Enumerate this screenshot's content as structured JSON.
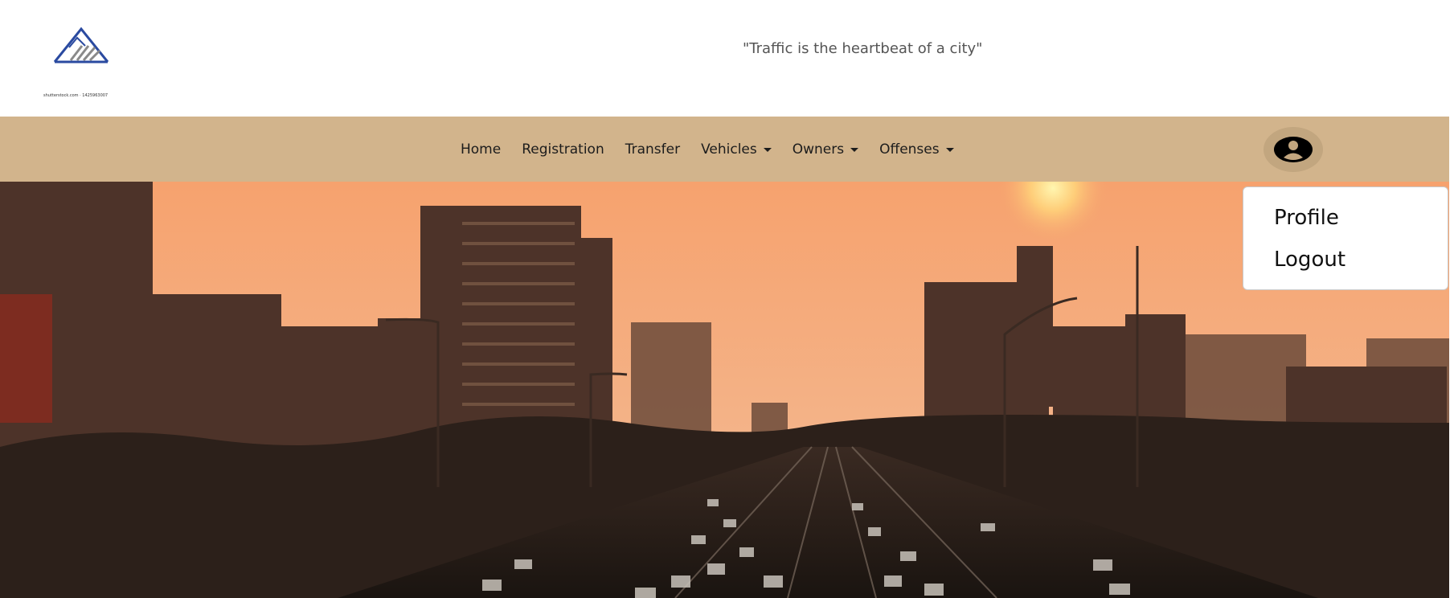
{
  "header": {
    "logo_caption": "shutterstock.com · 1425963007",
    "tagline": "\"Traffic is the heartbeat of a city\""
  },
  "nav": {
    "items": [
      {
        "label": "Home",
        "has_dropdown": false
      },
      {
        "label": "Registration",
        "has_dropdown": false
      },
      {
        "label": "Transfer",
        "has_dropdown": false
      },
      {
        "label": "Vehicles",
        "has_dropdown": true
      },
      {
        "label": "Owners",
        "has_dropdown": true
      },
      {
        "label": "Offenses",
        "has_dropdown": true
      }
    ],
    "profile_icon": "user-circle-icon"
  },
  "profile_menu": {
    "items": [
      "Profile",
      "Logout"
    ]
  },
  "hero": {
    "image": "city-traffic-sunset-photo"
  },
  "colors": {
    "navbar": "#d2b48c",
    "profile_button": "#c2a67f",
    "logo_blue": "#2a4aa0",
    "logo_gray": "#8a8a8a"
  }
}
